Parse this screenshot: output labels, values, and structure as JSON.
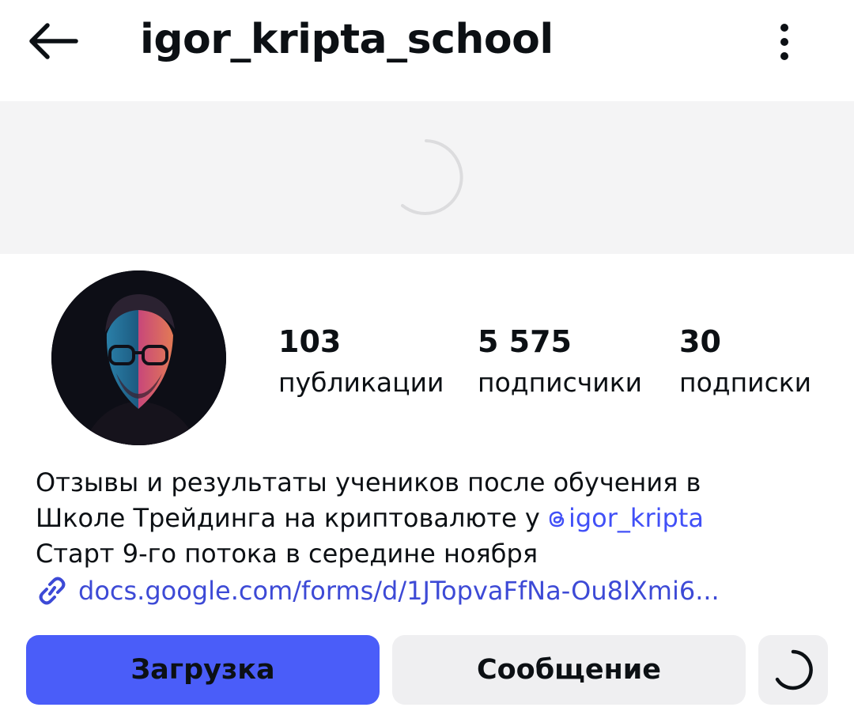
{
  "header": {
    "username": "igor_kripta_school",
    "back_icon": "arrow-left-icon",
    "more_icon": "more-vertical-icon"
  },
  "banner": {
    "loading_icon": "spinner-icon"
  },
  "profile": {
    "avatar_icon": "avatar",
    "stats": {
      "posts": {
        "value": "103",
        "label": "публикации"
      },
      "followers": {
        "value": "5 575",
        "label": "подписчики"
      },
      "following": {
        "value": "30",
        "label": "подписки"
      }
    }
  },
  "bio": {
    "line1": "Отзывы и результаты учеников после обучения в",
    "line2_text": "Школе Трейдинга на криптовалюте у ",
    "line2_mention": "igor_kripta",
    "line3": "Старт 9-го потока в середине ноября",
    "link": "docs.google.com/forms/d/1JTopvaFfNa-Ou8lXmi6..."
  },
  "actions": {
    "primary_label": "Загрузка",
    "message_label": "Сообщение",
    "third_icon": "spinner-icon"
  },
  "colors": {
    "accent": "#4a5df9",
    "link": "#3d4ad6",
    "secondary_button": "#efeff1",
    "banner": "#f4f4f5"
  }
}
